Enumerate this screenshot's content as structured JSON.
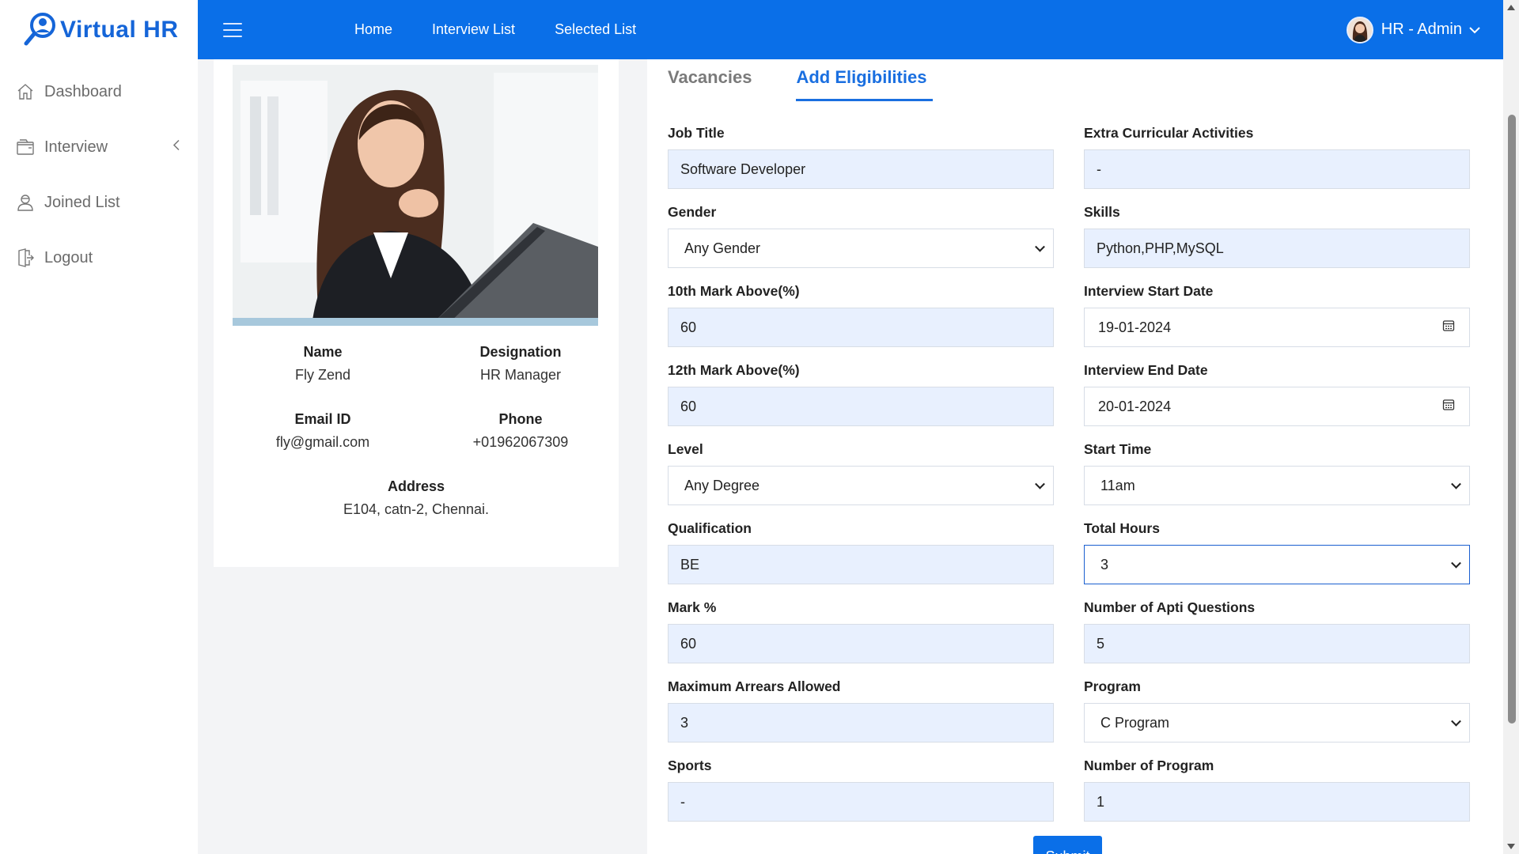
{
  "app": {
    "brand": "Virtual HR"
  },
  "sidebar": {
    "items": [
      {
        "label": "Dashboard",
        "icon": "home-icon"
      },
      {
        "label": "Interview",
        "icon": "folder-icon"
      },
      {
        "label": "Joined List",
        "icon": "user-icon"
      },
      {
        "label": "Logout",
        "icon": "logout-icon"
      }
    ]
  },
  "topbar": {
    "links": [
      "Home",
      "Interview List",
      "Selected List"
    ],
    "user": "HR - Admin"
  },
  "profile": {
    "name_label": "Name",
    "name": "Fly Zend",
    "designation_label": "Designation",
    "designation": "HR Manager",
    "email_label": "Email ID",
    "email": "fly@gmail.com",
    "phone_label": "Phone",
    "phone": "+01962067309",
    "address_label": "Address",
    "address": "E104, catn-2, Chennai."
  },
  "tabs": [
    "Vacancies",
    "Add Eligibilities"
  ],
  "form": {
    "job_title": {
      "label": "Job Title",
      "value": "Software Developer"
    },
    "extra": {
      "label": "Extra Curricular Activities",
      "value": "-"
    },
    "gender": {
      "label": "Gender",
      "value": "Any Gender"
    },
    "skills": {
      "label": "Skills",
      "value": "Python,PHP,MySQL"
    },
    "tenth": {
      "label": "10th Mark Above(%)",
      "value": "60"
    },
    "start_date": {
      "label": "Interview Start Date",
      "value": "19-01-2024"
    },
    "twelfth": {
      "label": "12th Mark Above(%)",
      "value": "60"
    },
    "end_date": {
      "label": "Interview End Date",
      "value": "20-01-2024"
    },
    "level": {
      "label": "Level",
      "value": "Any Degree"
    },
    "start_time": {
      "label": "Start Time",
      "value": "11am"
    },
    "qualification": {
      "label": "Qualification",
      "value": "BE"
    },
    "total_hours": {
      "label": "Total Hours",
      "value": "3"
    },
    "mark": {
      "label": "Mark %",
      "value": "60"
    },
    "apti": {
      "label": "Number of Apti Questions",
      "value": "5"
    },
    "arrears": {
      "label": "Maximum Arrears Allowed",
      "value": "3"
    },
    "program": {
      "label": "Program",
      "value": "C Program"
    },
    "sports": {
      "label": "Sports",
      "value": "-"
    },
    "num_program": {
      "label": "Number of Program",
      "value": "1"
    },
    "submit": "Submit"
  },
  "colors": {
    "primary": "#0a6fe8",
    "input_bg": "#e8f0fe",
    "active_tab": "#1a6fe0"
  }
}
